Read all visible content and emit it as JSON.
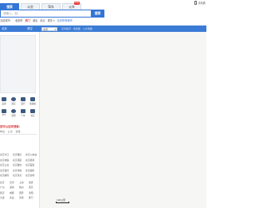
{
  "tabs": [
    {
      "label": "搜索",
      "active": true
    },
    {
      "label": "公交",
      "active": false
    },
    {
      "label": "驾车",
      "active": false
    },
    {
      "label": "火车",
      "active": false,
      "badge": "new"
    }
  ],
  "topright": {
    "label": "手机看"
  },
  "search": {
    "placeholder": "请输入，如：",
    "button": "搜索"
  },
  "hotrow": {
    "city_label": "当前城市：",
    "city": "北京市",
    "hot": "热门",
    "a": "酒店",
    "b": "景点",
    "more": "更多 ▾",
    "link": "北京所有城市"
  },
  "bar": {
    "label": "北京",
    "clear": "清空",
    "city": "北京",
    "layers": "实时路况  ·  地铁图  ·  公交地图"
  },
  "icons": {
    "row1": [
      {
        "name": "food-icon",
        "label": "美食"
      },
      {
        "name": "hotel-icon",
        "label": "酒店"
      },
      {
        "name": "bank-icon",
        "label": "银行"
      },
      {
        "name": "gas-icon",
        "label": "加油站"
      }
    ],
    "row2": [
      {
        "name": "ktv-icon",
        "label": "KTV"
      },
      {
        "name": "bar-icon",
        "label": "酒吧"
      },
      {
        "name": "car-icon",
        "label": "汽车"
      },
      {
        "name": "book-icon",
        "label": "书店"
      }
    ]
  },
  "ask": {
    "title": "您可以这样搜索：",
    "sub": "地址  ·  公交  ·  道路"
  },
  "quicklinks": [
    [
      "北京户口",
      "北京租房",
      "北京火车站"
    ],
    [
      "北京地铁",
      "北京酒店",
      "北京机场"
    ],
    [
      "北京公交",
      "北京餐饮",
      "北京医院"
    ],
    [
      "北京银行",
      "北京学校",
      "北京超市"
    ],
    [
      "北京邮局",
      "北京景点",
      "北京商场"
    ]
  ],
  "quicklinks2": [
    [
      "北京",
      "天津",
      "上海",
      "重庆"
    ],
    [
      "广州",
      "深圳",
      "杭州",
      "南京"
    ],
    [
      "武汉",
      "成都",
      "西安",
      "沈阳"
    ],
    [
      "大连",
      "青岛",
      "济南",
      "厦门"
    ]
  ],
  "map": {
    "scale": "100公里"
  }
}
